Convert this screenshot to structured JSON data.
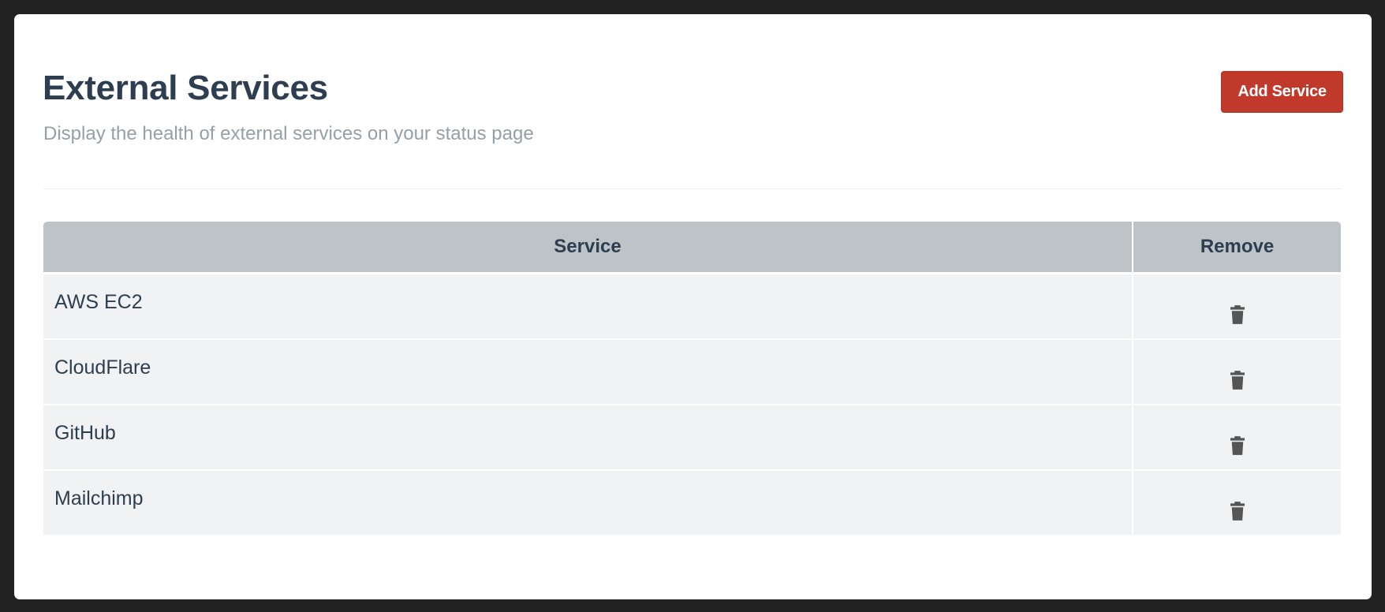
{
  "header": {
    "title": "External Services",
    "subtitle": "Display the health of external services on your status page",
    "add_button_label": "Add Service"
  },
  "table": {
    "columns": {
      "service": "Service",
      "remove": "Remove"
    },
    "rows": [
      {
        "service": "AWS EC2",
        "remove_icon": "trash-icon"
      },
      {
        "service": "CloudFlare",
        "remove_icon": "trash-icon"
      },
      {
        "service": "GitHub",
        "remove_icon": "trash-icon"
      },
      {
        "service": "Mailchimp",
        "remove_icon": "trash-icon"
      }
    ]
  },
  "colors": {
    "primary_text": "#2c3e50",
    "muted_text": "#95a0a6",
    "accent": "#c0392b",
    "table_header_bg": "#bdc3c7",
    "table_row_bg": "#f0f2f4",
    "icon": "#555555"
  }
}
